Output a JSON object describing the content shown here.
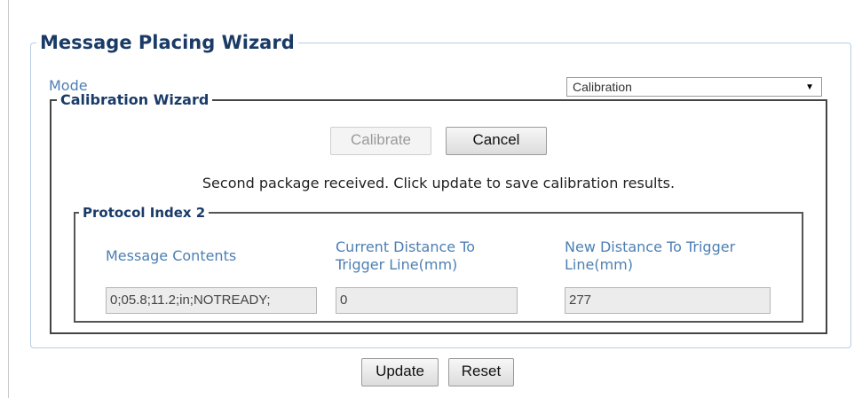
{
  "wizard": {
    "title": "Message Placing Wizard",
    "mode_label": "Mode",
    "mode_value": "Calibration",
    "calibration": {
      "title": "Calibration Wizard",
      "calibrate_label": "Calibrate",
      "cancel_label": "Cancel",
      "status_message": "Second package received. Click update to save calibration results.",
      "protocol": {
        "title": "Protocol Index 2",
        "headers": {
          "message_contents": "Message Contents",
          "current_distance": "Current Distance To Trigger Line(mm)",
          "new_distance": "New Distance To Trigger Line(mm)"
        },
        "values": {
          "message_contents": "0;05.8;11.2;in;NOTREADY;",
          "current_distance": "0",
          "new_distance": "277"
        }
      }
    }
  },
  "footer": {
    "update_label": "Update",
    "reset_label": "Reset"
  }
}
